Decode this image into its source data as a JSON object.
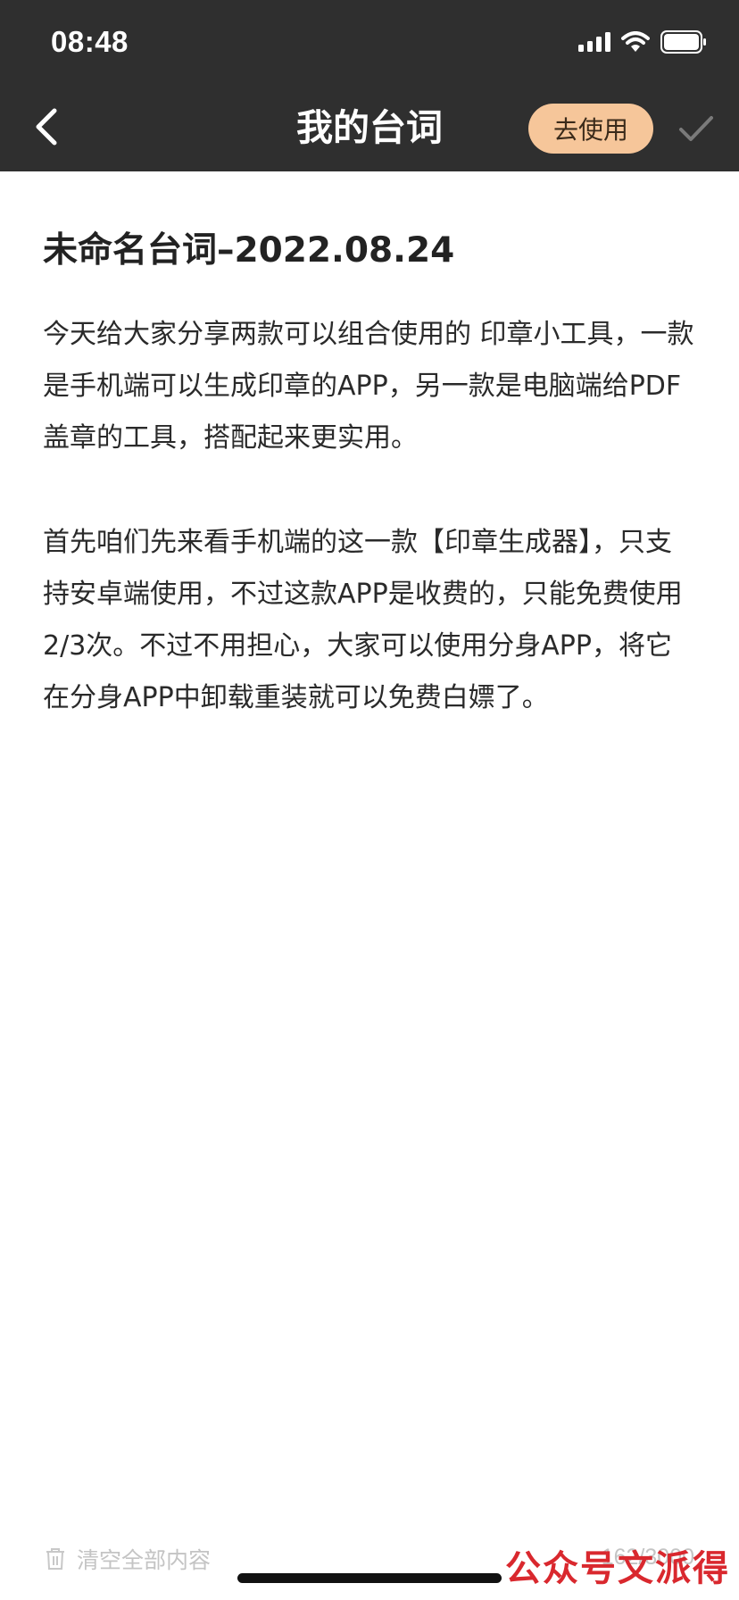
{
  "status_bar": {
    "time": "08:48",
    "icons": [
      "signal-icon",
      "wifi-icon",
      "battery-icon"
    ]
  },
  "nav": {
    "title": "我的台词",
    "use_label": "去使用",
    "accent_color": "#f6c69a"
  },
  "document": {
    "title": "未命名台词–2022.08.24",
    "paragraphs": [
      "今天给大家分享两款可以组合使用的 印章小工具，一款是手机端可以生成印章的APP，另一款是电脑端给PDF盖章的工具，搭配起来更实用。",
      "首先咱们先来看手机端的这一款【印章生成器】，只支持安卓端使用，不过这款APP是收费的，只能免费使用2/3次。不过不用担心，大家可以使用分身APP，将它在分身APP中卸载重装就可以免费白嫖了。"
    ]
  },
  "footer": {
    "clear_label": "清空全部内容",
    "counter": "162/3000",
    "watermark": "公众号文派得"
  }
}
